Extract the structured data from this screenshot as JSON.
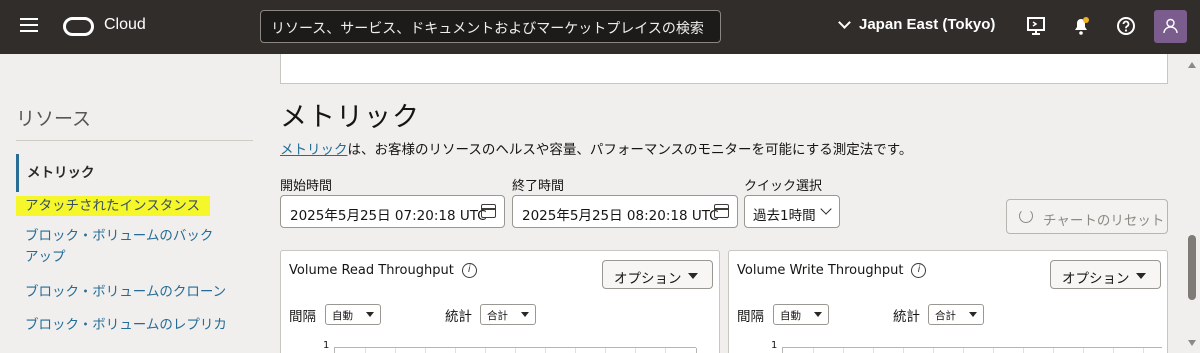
{
  "header": {
    "brand": "Cloud",
    "search_placeholder": "リソース、サービス、ドキュメントおよびマーケットプレイスの検索",
    "region": "Japan East (Tokyo)"
  },
  "sidebar": {
    "title": "リソース",
    "items": [
      {
        "label": "メトリック"
      },
      {
        "label": "アタッチされたインスタンス"
      },
      {
        "label": "ブロック・ボリュームのバックアップ"
      },
      {
        "label": "ブロック・ボリュームのクローン"
      },
      {
        "label": "ブロック・ボリュームのレプリカ"
      }
    ]
  },
  "main": {
    "title": "メトリック",
    "desc_link": "メトリック",
    "desc_rest": "は、お客様のリソースのヘルスや容量、パフォーマンスのモニターを可能にする測定法です。",
    "start_label": "開始時間",
    "start_value": "2025年5月25日 07:20:18 UTC",
    "end_label": "終了時間",
    "end_value": "2025年5月25日 08:20:18 UTC",
    "quick_label": "クイック選択",
    "quick_value": "過去1時間",
    "reset_label": "チャートのリセット"
  },
  "charts": [
    {
      "title": "Volume Read Throughput",
      "options": "オプション",
      "interval_label": "間隔",
      "interval_value": "自動",
      "stat_label": "統計",
      "stat_value": "合計",
      "axis_top": "1"
    },
    {
      "title": "Volume Write Throughput",
      "options": "オプション",
      "interval_label": "間隔",
      "interval_value": "自動",
      "stat_label": "統計",
      "stat_value": "合計",
      "axis_top": "1"
    }
  ]
}
